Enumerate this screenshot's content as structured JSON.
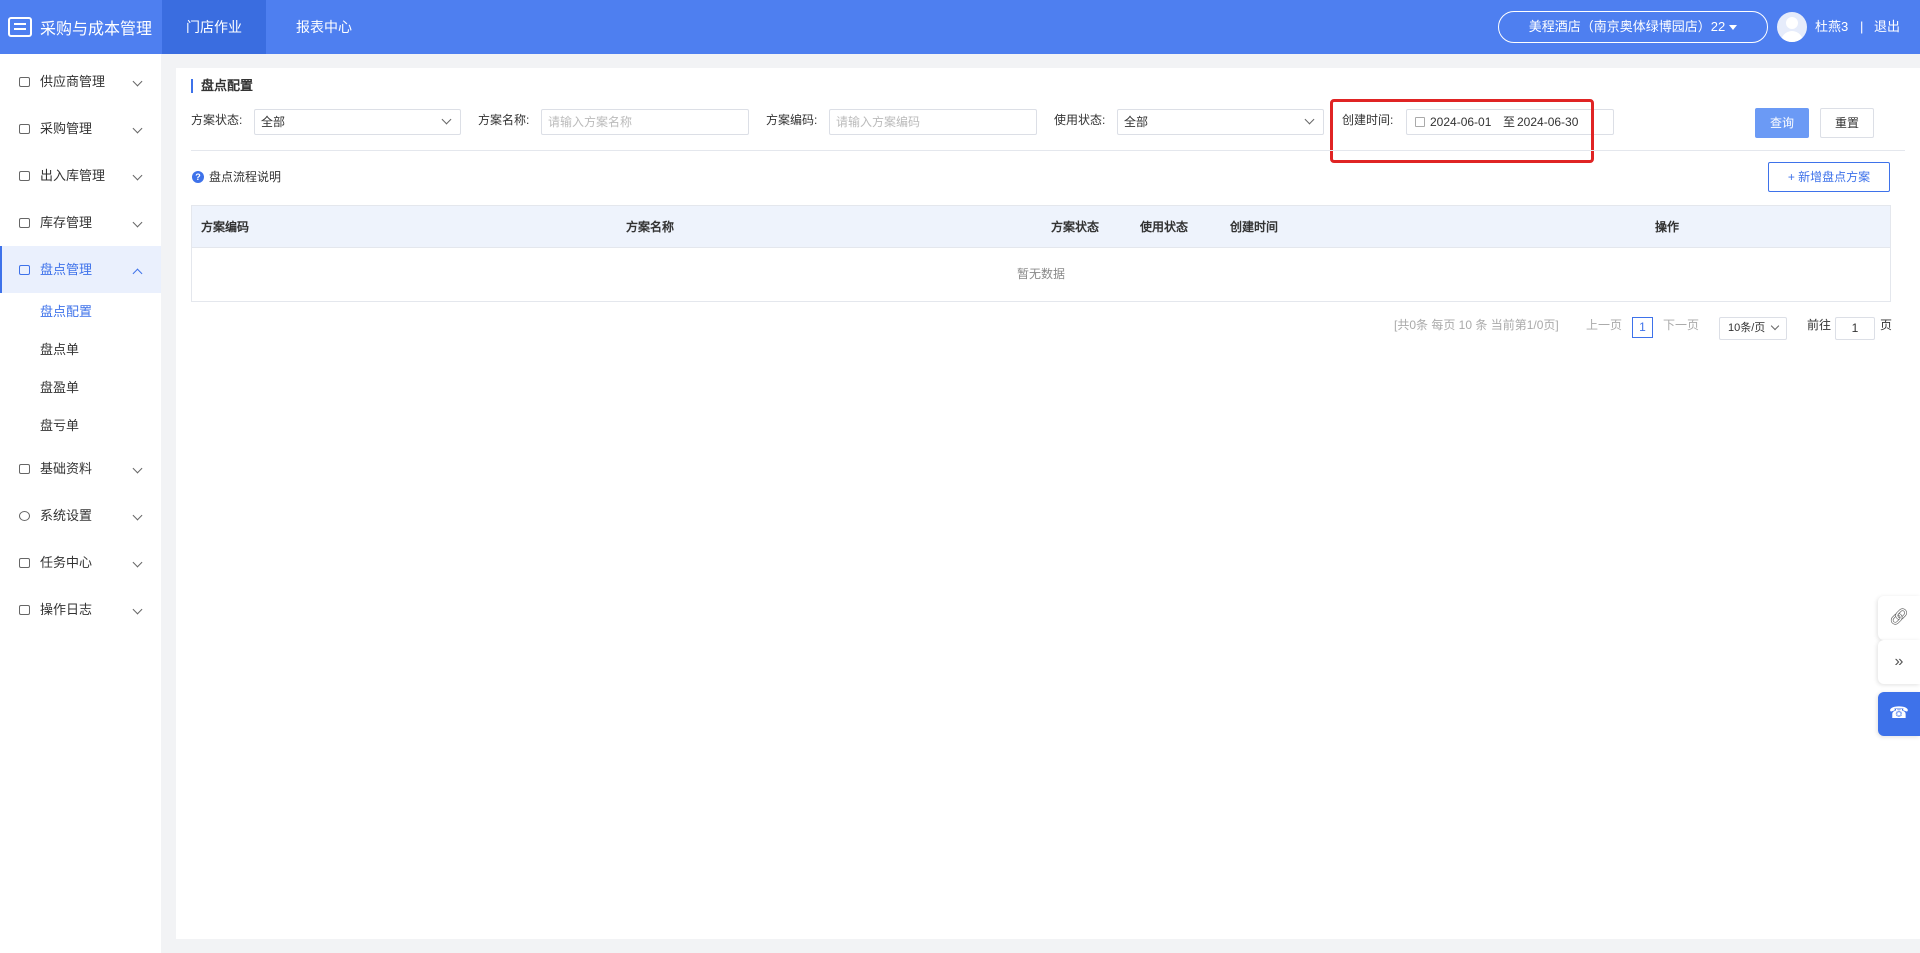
{
  "app": {
    "title": "采购与成本管理",
    "tabs": [
      {
        "label": "门店作业",
        "active": true
      },
      {
        "label": "报表中心",
        "active": false
      }
    ],
    "store": "美程酒店（南京奥体绿博园店）22",
    "user": "杜燕3",
    "separator": "|",
    "logout": "退出",
    "accent_color": "#4e7ff0"
  },
  "sidebar": {
    "items": [
      {
        "label": "供应商管理",
        "icon": "supplier-icon"
      },
      {
        "label": "采购管理",
        "icon": "purchase-icon"
      },
      {
        "label": "出入库管理",
        "icon": "stock-io-icon"
      },
      {
        "label": "库存管理",
        "icon": "inventory-icon"
      },
      {
        "label": "盘点管理",
        "icon": "stocktake-icon",
        "open": true,
        "children": [
          "盘点配置",
          "盘点单",
          "盘盈单",
          "盘亏单"
        ],
        "active_child": "盘点配置"
      },
      {
        "label": "基础资料",
        "icon": "basic-data-icon"
      },
      {
        "label": "系统设置",
        "icon": "settings-icon"
      },
      {
        "label": "任务中心",
        "icon": "task-icon"
      },
      {
        "label": "操作日志",
        "icon": "log-icon"
      }
    ]
  },
  "page": {
    "title": "盘点配置",
    "filters": {
      "plan_status_label": "方案状态:",
      "plan_status_value": "全部",
      "plan_name_label": "方案名称:",
      "plan_name_placeholder": "请输入方案名称",
      "plan_code_label": "方案编码:",
      "plan_code_placeholder": "请输入方案编码",
      "use_status_label": "使用状态:",
      "use_status_value": "全部",
      "created_label": "创建时间:",
      "date_start": "2024-06-01",
      "date_to": "至",
      "date_end": "2024-06-30"
    },
    "query_button": "查询",
    "reset_button": "重置",
    "help_text": "盘点流程说明",
    "add_button": "+ 新增盘点方案"
  },
  "table": {
    "columns": [
      "方案编码",
      "方案名称",
      "方案状态",
      "使用状态",
      "创建时间",
      "操作"
    ],
    "rows": [],
    "empty_text": "暂无数据"
  },
  "pagination": {
    "summary": "[共0条 每页 10 条 当前第1/0页]",
    "prev": "上一页",
    "current_page": "1",
    "next": "下一页",
    "page_size": "10条/页",
    "goto_label": "前往",
    "goto_value": "1",
    "page_suffix": "页"
  },
  "float_tools": [
    "link-icon",
    "collapse-icon",
    "customer-service-icon"
  ]
}
